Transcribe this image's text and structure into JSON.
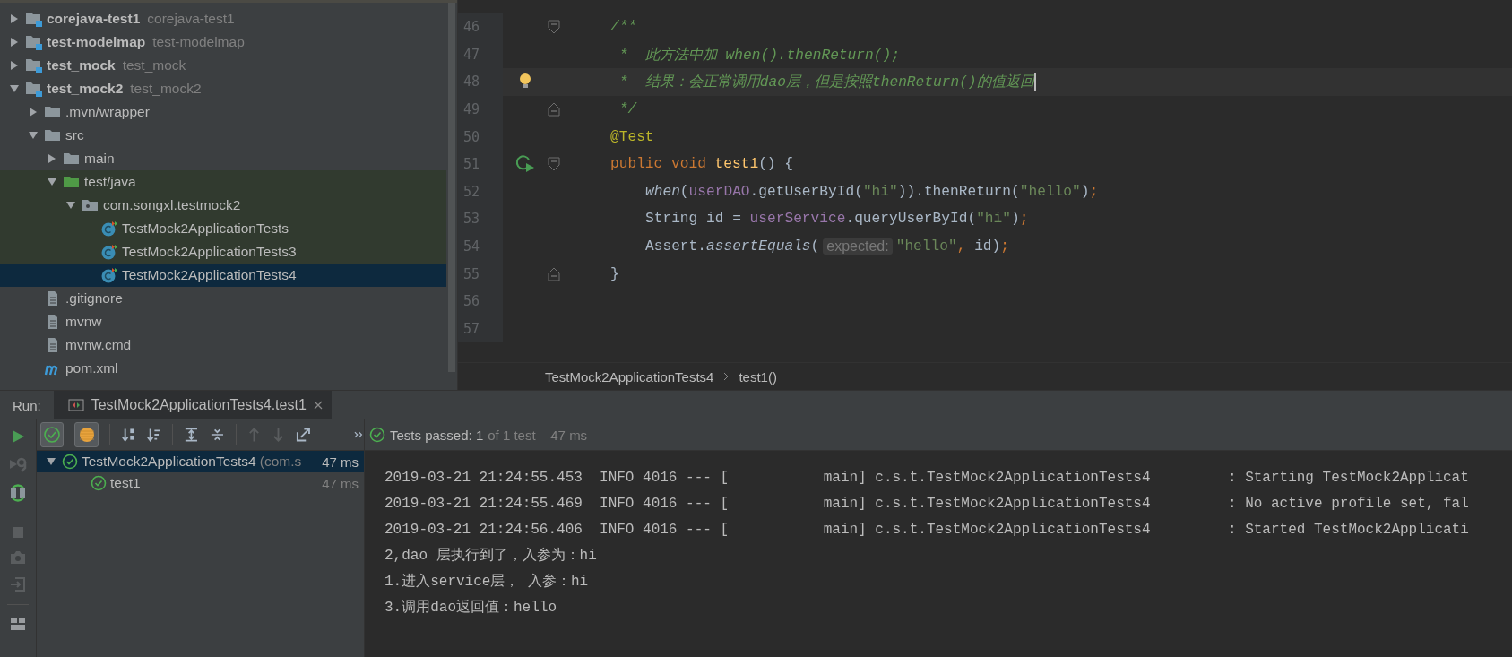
{
  "project_tree": [
    {
      "label": "corejava-test1",
      "detail": "corejava-test1",
      "kind": "module",
      "expanded": false,
      "selected": false
    },
    {
      "label": "test-modelmap",
      "detail": "test-modelmap",
      "kind": "module",
      "expanded": false,
      "selected": false
    },
    {
      "label": "test_mock",
      "detail": "test_mock",
      "kind": "module",
      "expanded": false,
      "selected": false
    },
    {
      "label": "test_mock2",
      "detail": "test_mock2",
      "kind": "module",
      "expanded": true,
      "selected": false,
      "children": [
        {
          "label": ".mvn/wrapper",
          "kind": "folder",
          "expanded": false,
          "selected": false
        },
        {
          "label": "src",
          "kind": "folder",
          "expanded": true,
          "selected": false,
          "children": [
            {
              "label": "main",
              "kind": "folder",
              "expanded": false,
              "selected": false
            },
            {
              "label": "test/java",
              "kind": "test-folder",
              "expanded": true,
              "selected": false,
              "children": [
                {
                  "label": "com.songxl.testmock2",
                  "kind": "package",
                  "expanded": true,
                  "selected": false,
                  "children": [
                    {
                      "label": "TestMock2ApplicationTests",
                      "kind": "class",
                      "selected": false
                    },
                    {
                      "label": "TestMock2ApplicationTests3",
                      "kind": "class",
                      "selected": false
                    },
                    {
                      "label": "TestMock2ApplicationTests4",
                      "kind": "class",
                      "selected": true
                    }
                  ]
                }
              ]
            }
          ]
        },
        {
          "label": ".gitignore",
          "kind": "file",
          "selected": false
        },
        {
          "label": "mvnw",
          "kind": "file",
          "selected": false
        },
        {
          "label": "mvnw.cmd",
          "kind": "file",
          "selected": false
        },
        {
          "label": "pom.xml",
          "kind": "maven",
          "selected": false
        }
      ]
    }
  ],
  "editor": {
    "lines": [
      {
        "number": "46",
        "kind": "fold-start",
        "indent": false,
        "current": false,
        "runnable": false,
        "tokens": [
          {
            "text": "/**",
            "kind": "comment"
          }
        ]
      },
      {
        "number": "47",
        "kind": "line",
        "indent": false,
        "current": false,
        "runnable": false,
        "tokens": [
          {
            "text": " *  此方法中加 when().thenReturn();",
            "kind": "comment"
          }
        ]
      },
      {
        "number": "48",
        "kind": "line",
        "indent": false,
        "current": true,
        "runnable": false,
        "tokens": [
          {
            "text": " *  结果：会正常调用dao层，但是按照thenReturn()的值返回",
            "kind": "comment"
          }
        ]
      },
      {
        "number": "49",
        "kind": "fold-end",
        "indent": false,
        "current": false,
        "runnable": false,
        "tokens": [
          {
            "text": " */",
            "kind": "comment"
          }
        ]
      },
      {
        "number": "50",
        "kind": "line",
        "indent": false,
        "current": false,
        "runnable": false,
        "tokens": [
          {
            "text": "@Test",
            "kind": "annotation"
          }
        ]
      },
      {
        "number": "51",
        "kind": "fold-start",
        "indent": false,
        "current": false,
        "runnable": true,
        "tokens": [
          {
            "text": "public void ",
            "kind": "keyword"
          },
          {
            "text": "test1",
            "kind": "declaration"
          },
          {
            "text": "() {",
            "kind": "plain"
          }
        ]
      },
      {
        "number": "52",
        "kind": "line",
        "indent": true,
        "current": false,
        "runnable": false,
        "tokens": [
          {
            "text": "when",
            "kind": "static"
          },
          {
            "text": "(",
            "kind": "plain"
          },
          {
            "text": "userDAO",
            "kind": "field"
          },
          {
            "text": ".getUserById(",
            "kind": "plain"
          },
          {
            "text": "\"hi\"",
            "kind": "string"
          },
          {
            "text": ")).thenReturn(",
            "kind": "plain"
          },
          {
            "text": "\"hello\"",
            "kind": "string"
          },
          {
            "text": ")",
            "kind": "plain"
          },
          {
            "text": ";",
            "kind": "keyword"
          }
        ]
      },
      {
        "number": "53",
        "kind": "line",
        "indent": true,
        "current": false,
        "runnable": false,
        "tokens": [
          {
            "text": "String id = ",
            "kind": "plain"
          },
          {
            "text": "userService",
            "kind": "field"
          },
          {
            "text": ".queryUserById(",
            "kind": "plain"
          },
          {
            "text": "\"hi\"",
            "kind": "string"
          },
          {
            "text": ")",
            "kind": "plain"
          },
          {
            "text": ";",
            "kind": "keyword"
          }
        ]
      },
      {
        "number": "54",
        "kind": "line",
        "indent": true,
        "current": false,
        "runnable": false,
        "tokens": [
          {
            "text": "Assert.",
            "kind": "plain"
          },
          {
            "text": "assertEquals",
            "kind": "static"
          },
          {
            "text": "(",
            "kind": "plain"
          },
          {
            "text": "expected:",
            "kind": "hint"
          },
          {
            "text": "\"hello\"",
            "kind": "string"
          },
          {
            "text": ", ",
            "kind": "keyword"
          },
          {
            "text": "id)",
            "kind": "plain"
          },
          {
            "text": ";",
            "kind": "keyword"
          }
        ]
      },
      {
        "number": "55",
        "kind": "fold-end",
        "indent": false,
        "current": false,
        "runnable": false,
        "tokens": [
          {
            "text": "}",
            "kind": "plain"
          }
        ]
      },
      {
        "number": "56",
        "kind": "line",
        "current": false,
        "runnable": false
      },
      {
        "number": "57",
        "kind": "line",
        "current": false,
        "runnable": false
      }
    ],
    "breadcrumb": [
      "TestMock2ApplicationTests4",
      "test1()"
    ]
  },
  "run": {
    "label": "Run:",
    "tab": {
      "title": "TestMock2ApplicationTests4.test1",
      "selected": true
    },
    "toggles": [
      {
        "kind": "passed",
        "on": true
      },
      {
        "kind": "ignored",
        "on": true
      }
    ],
    "status": {
      "summary": "Tests passed: 1",
      "detail": "of 1 test – 47 ms"
    },
    "tests": [
      {
        "name": "TestMock2ApplicationTests4",
        "qualifier": "(com.s",
        "time": "47 ms",
        "expanded": true,
        "selected": true,
        "children": [
          {
            "name": "test1",
            "time": "47 ms",
            "selected": false
          }
        ]
      }
    ],
    "console": [
      "2019-03-21 21:24:55.453  INFO 4016 --- [           main] c.s.t.TestMock2ApplicationTests4         : Starting TestMock2Applicat",
      "2019-03-21 21:24:55.469  INFO 4016 --- [           main] c.s.t.TestMock2ApplicationTests4         : No active profile set, fal",
      "2019-03-21 21:24:56.406  INFO 4016 --- [           main] c.s.t.TestMock2ApplicationTests4         : Started TestMock2Applicati",
      "2,dao 层执行到了，入参为：hi",
      "1.进入service层， 入参：hi",
      "3.调用dao返回值：hello"
    ]
  }
}
